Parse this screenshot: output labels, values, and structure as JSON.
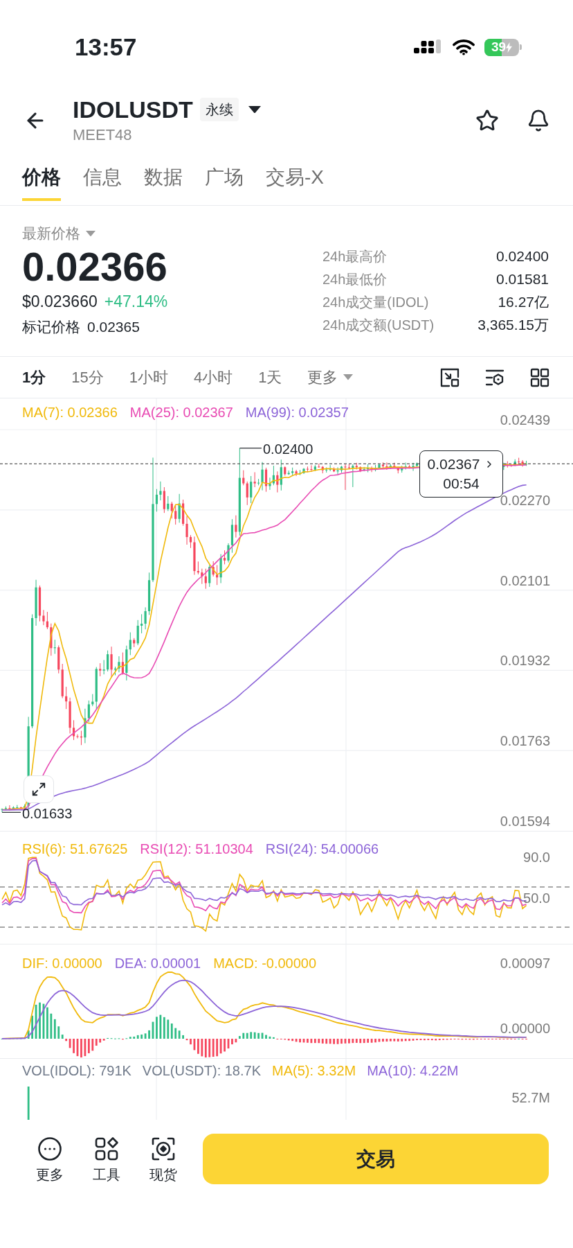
{
  "status_bar": {
    "time": "13:57",
    "battery": "39"
  },
  "header": {
    "symbol": "IDOLUSDT",
    "contract_tag": "永续",
    "subtitle": "MEET48"
  },
  "tabs": [
    {
      "label": "价格",
      "selected": true
    },
    {
      "label": "信息",
      "selected": false
    },
    {
      "label": "数据",
      "selected": false
    },
    {
      "label": "广场",
      "selected": false
    },
    {
      "label": "交易-X",
      "selected": false
    }
  ],
  "price": {
    "label": "最新价格",
    "last": "0.02366",
    "usd": "$0.023660",
    "change": "+47.14%",
    "mark_label": "标记价格",
    "mark": "0.02365"
  },
  "stats": [
    {
      "label": "24h最高价",
      "value": "0.02400"
    },
    {
      "label": "24h最低价",
      "value": "0.01581"
    },
    {
      "label": "24h成交量(IDOL)",
      "value": "16.27亿"
    },
    {
      "label": "24h成交额(USDT)",
      "value": "3,365.15万"
    }
  ],
  "intervals": [
    {
      "label": "1分",
      "selected": true,
      "kind": "interval"
    },
    {
      "label": "15分",
      "selected": false,
      "kind": "interval"
    },
    {
      "label": "1小时",
      "selected": false,
      "kind": "interval"
    },
    {
      "label": "4小时",
      "selected": false,
      "kind": "interval"
    },
    {
      "label": "1天",
      "selected": false,
      "kind": "interval"
    },
    {
      "label": "更多",
      "selected": false,
      "kind": "menu"
    }
  ],
  "chart": {
    "legend": [
      {
        "label": "MA(7): 0.02366",
        "color": "#f0b90b"
      },
      {
        "label": "MA(25): 0.02367",
        "color": "#e84bb3"
      },
      {
        "label": "MA(99): 0.02357",
        "color": "#8c64d8"
      }
    ],
    "y_labels": [
      "0.02439",
      "0.02270",
      "0.02101",
      "0.01932",
      "0.01763",
      "0.01594"
    ],
    "high_label": "0.02400",
    "low_label": "0.01633",
    "price_tag": {
      "price": "0.02367",
      "countdown": "00:54"
    }
  },
  "rsi": {
    "legend": [
      {
        "label": "RSI(6): 51.67625",
        "color": "#f0b90b"
      },
      {
        "label": "RSI(12): 51.10304",
        "color": "#e84bb3"
      },
      {
        "label": "RSI(24): 54.00066",
        "color": "#8c64d8"
      }
    ],
    "y_labels": [
      "90.0",
      "50.0"
    ]
  },
  "macd": {
    "legend": [
      {
        "label": "DIF: 0.00000",
        "color": "#f0b90b"
      },
      {
        "label": "DEA: 0.00001",
        "color": "#8c64d8"
      },
      {
        "label": "MACD: -0.00000",
        "color": "#f0b90b"
      }
    ],
    "y_labels": [
      "0.00097",
      "0.00000"
    ]
  },
  "volume": {
    "legend": [
      {
        "label": "VOL(IDOL): 791K",
        "color": "#707a8a"
      },
      {
        "label": "VOL(USDT): 18.7K",
        "color": "#707a8a"
      },
      {
        "label": "MA(5): 3.32M",
        "color": "#f0b90b"
      },
      {
        "label": "MA(10): 4.22M",
        "color": "#8c64d8"
      }
    ],
    "y_labels": [
      "52.7M"
    ]
  },
  "bottom_bar": {
    "actions": [
      {
        "label": "更多",
        "kind": "more"
      },
      {
        "label": "工具",
        "kind": "tools"
      },
      {
        "label": "现货",
        "kind": "spot"
      }
    ],
    "trade_button": "交易"
  }
}
